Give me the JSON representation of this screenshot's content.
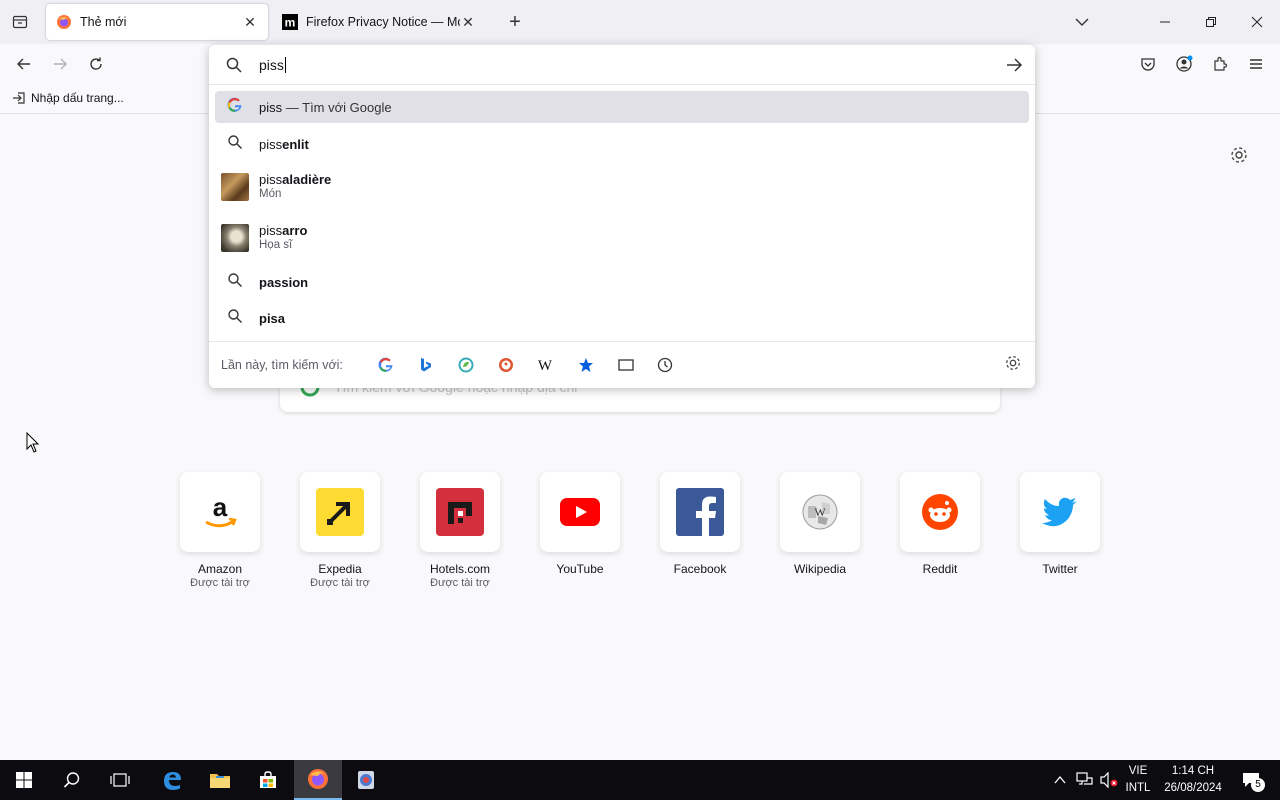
{
  "tabs": [
    {
      "title": "Thẻ mới",
      "active": true
    },
    {
      "title": "Firefox Privacy Notice — Mozilla",
      "active": false
    }
  ],
  "bookmarks": {
    "import_label": "Nhập dấu trang..."
  },
  "urlbar": {
    "value": "piss",
    "suggestions": [
      {
        "typed": "piss",
        "suffix": "",
        "action": "— Tìm với Google",
        "sub": "",
        "icon": "google-icon"
      },
      {
        "typed": "piss",
        "suffix": "enlit",
        "action": "",
        "sub": "",
        "icon": "search-icon"
      },
      {
        "typed": "piss",
        "suffix": "aladière",
        "action": "",
        "sub": "Món",
        "icon": "food-thumbnail"
      },
      {
        "typed": "piss",
        "suffix": "arro",
        "action": "",
        "sub": "Họa sĩ",
        "icon": "portrait-thumbnail"
      },
      {
        "typed": "",
        "suffix": "passion",
        "action": "",
        "sub": "",
        "icon": "search-icon"
      },
      {
        "typed": "",
        "suffix": "pisa",
        "action": "",
        "sub": "",
        "icon": "search-icon"
      }
    ],
    "oneoff_label": "Lần này, tìm kiếm với:",
    "engines": [
      "google",
      "bing",
      "ecosia",
      "duckduckgo",
      "wikipedia",
      "bookmarks",
      "tabs",
      "history"
    ]
  },
  "newtab": {
    "search_placeholder": "Tìm kiếm với Google hoặc nhập địa chỉ",
    "tiles": [
      {
        "label": "Amazon",
        "sponsor": "Được tài trợ"
      },
      {
        "label": "Expedia",
        "sponsor": "Được tài trợ"
      },
      {
        "label": "Hotels.com",
        "sponsor": "Được tài trợ"
      },
      {
        "label": "YouTube",
        "sponsor": ""
      },
      {
        "label": "Facebook",
        "sponsor": ""
      },
      {
        "label": "Wikipedia",
        "sponsor": ""
      },
      {
        "label": "Reddit",
        "sponsor": ""
      },
      {
        "label": "Twitter",
        "sponsor": ""
      }
    ]
  },
  "taskbar": {
    "lang1": "VIE",
    "lang2": "INTL",
    "time": "1:14 CH",
    "date": "26/08/2024",
    "notification_count": "5"
  },
  "colors": {
    "accent": "#0060df",
    "selected_row": "#e0e0e6",
    "taskbar": "#0c0c10"
  }
}
